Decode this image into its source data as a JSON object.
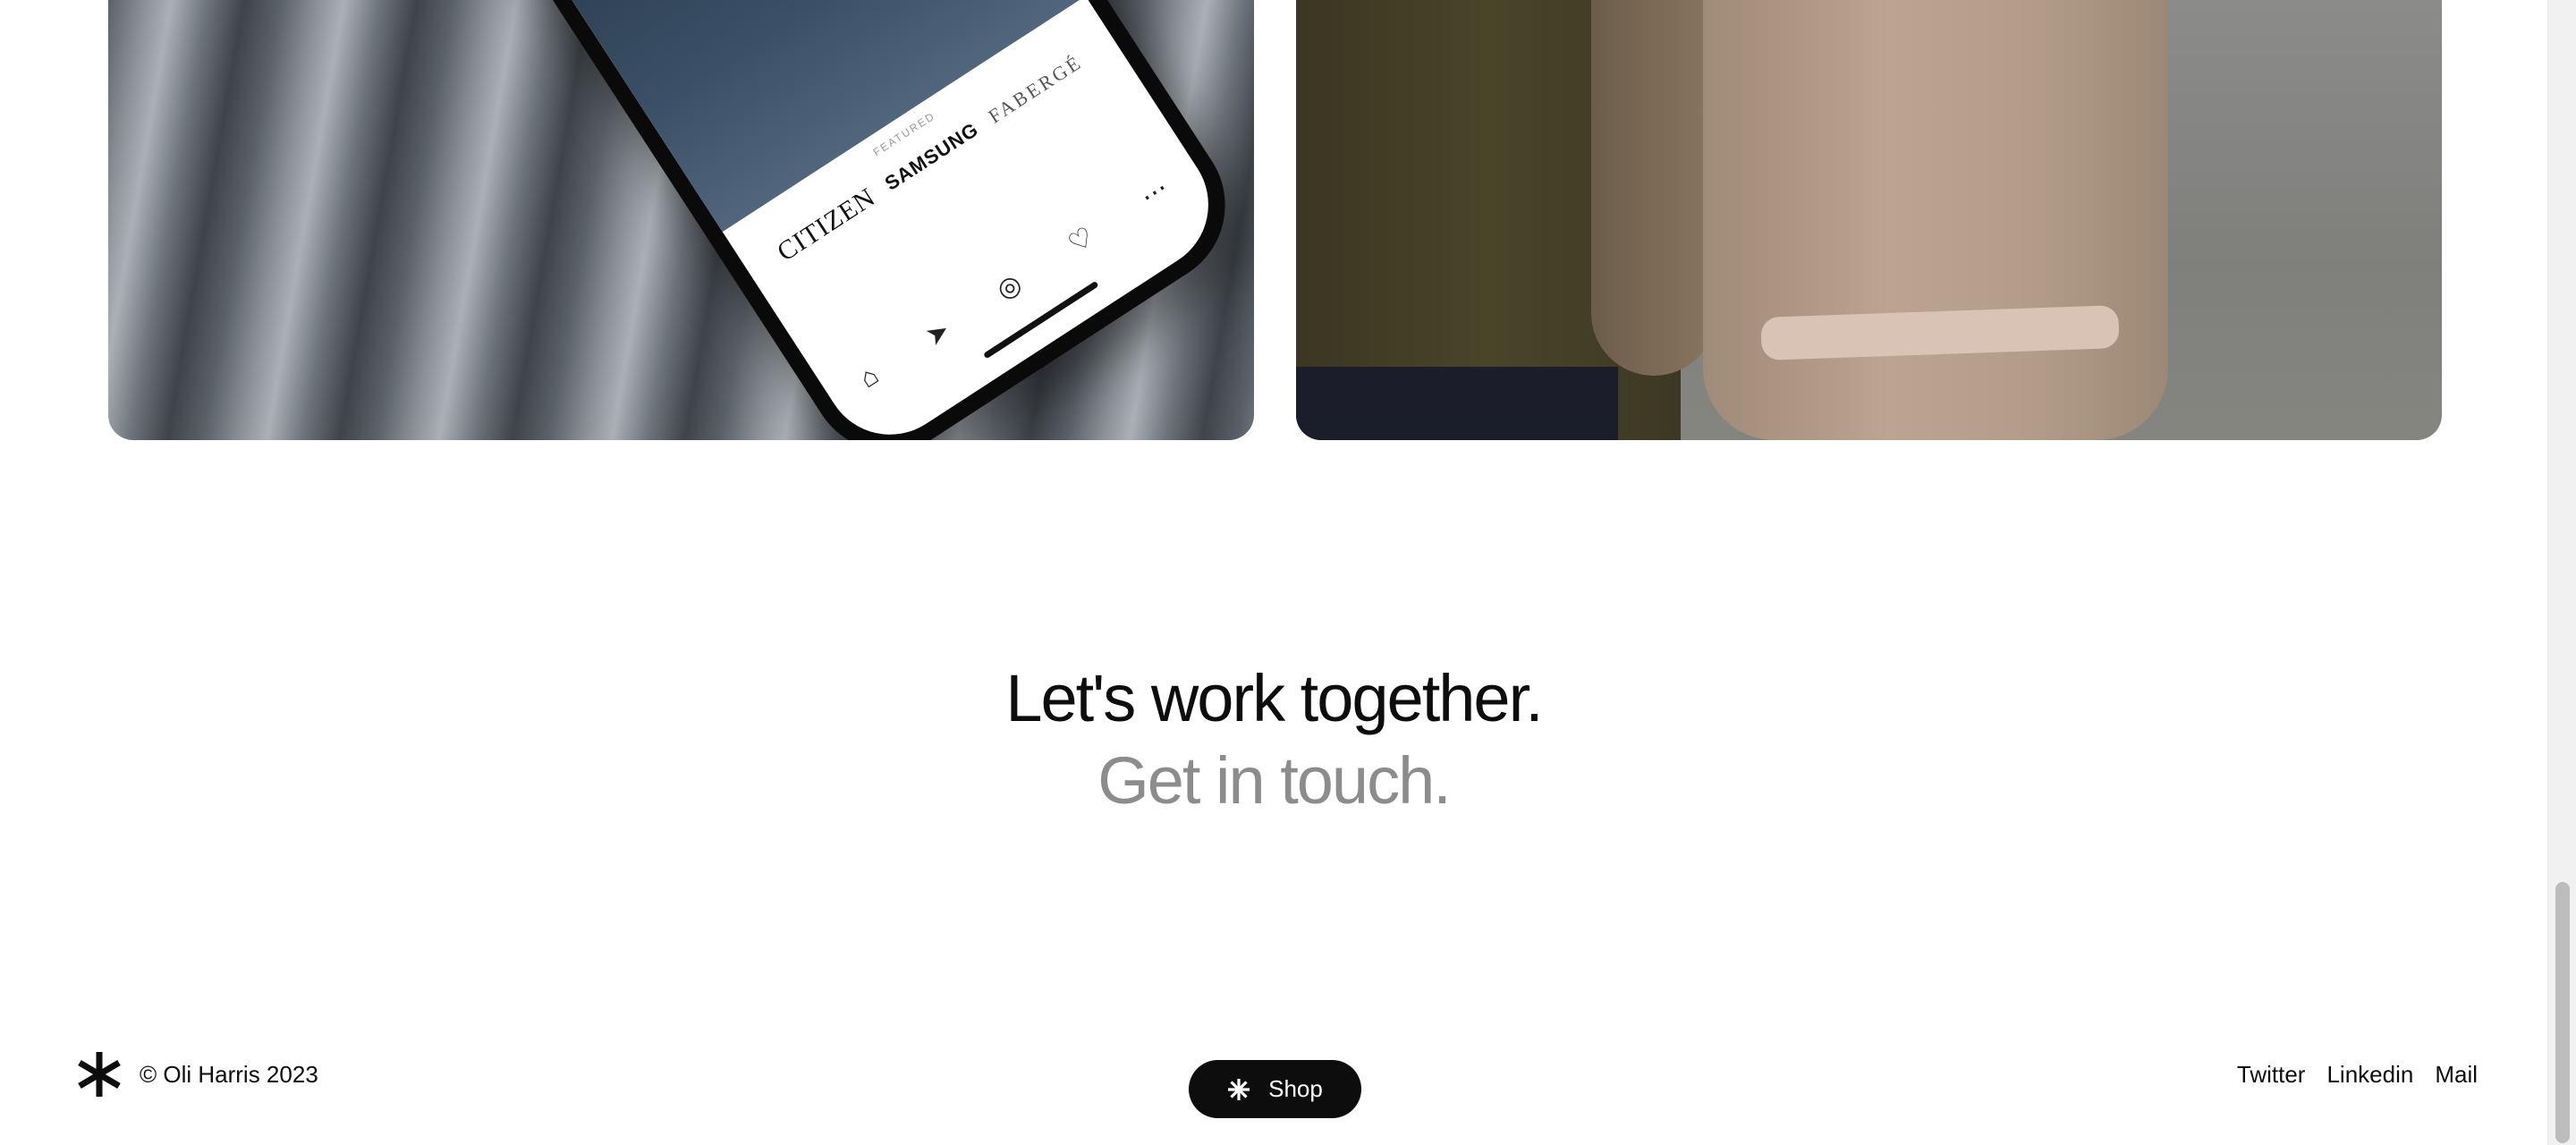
{
  "projects": {
    "phone_app": {
      "featured_label": "FEATURED",
      "brands": [
        "CITIZEN",
        "SAMSUNG",
        "FABERGÉ"
      ]
    }
  },
  "cta": {
    "line1": "Let's work together.",
    "line2": "Get in touch."
  },
  "footer": {
    "copyright": "© Oli Harris 2023",
    "shop_label": "Shop",
    "links": {
      "twitter": "Twitter",
      "linkedin": "Linkedin",
      "mail": "Mail"
    }
  },
  "icons": {
    "logo": "asterisk-logo-icon",
    "shop": "asterisk-icon"
  },
  "colors": {
    "text": "#0d0d0d",
    "muted": "#8c8c8c",
    "button_bg": "#0d0d0d",
    "background": "#ffffff"
  }
}
